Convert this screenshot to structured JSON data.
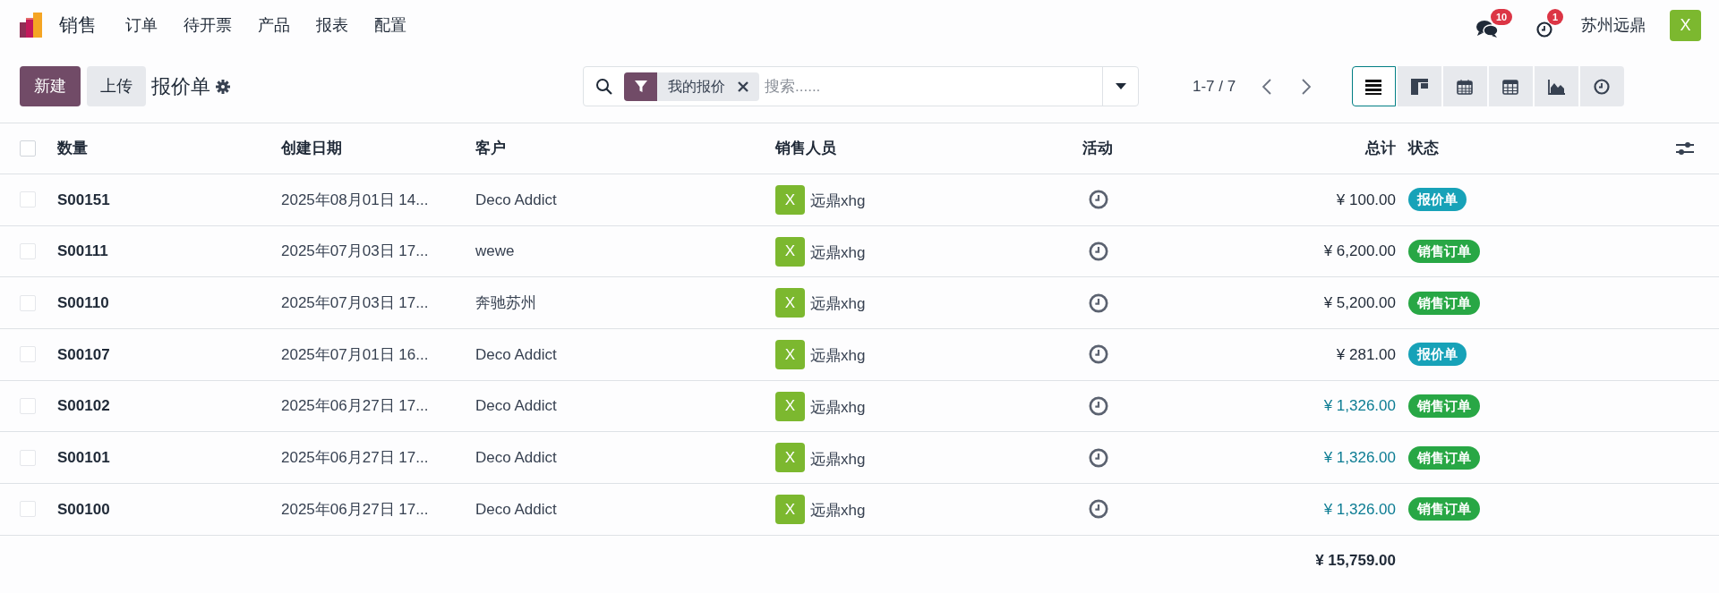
{
  "nav": {
    "app": "销售",
    "menu": [
      "订单",
      "待开票",
      "产品",
      "报表",
      "配置"
    ],
    "messages_count": "10",
    "activities_count": "1",
    "company": "苏州远鼎",
    "avatar": "X"
  },
  "control": {
    "new_button": "新建",
    "upload_button": "上传",
    "title": "报价单",
    "facet": "我的报价",
    "placeholder": "搜索......",
    "pager": "1-7 / 7",
    "views": [
      {
        "kind": "list",
        "selected": true
      },
      {
        "kind": "kanban",
        "selected": false
      },
      {
        "kind": "calendar",
        "selected": false
      },
      {
        "kind": "pivot",
        "selected": false
      },
      {
        "kind": "graph",
        "selected": false
      },
      {
        "kind": "activity",
        "selected": false
      }
    ]
  },
  "table": {
    "all_checked": false,
    "columns": [
      "数量",
      "创建日期",
      "客户",
      "销售人员",
      "活动",
      "总计",
      "状态"
    ],
    "rows": [
      {
        "number": "S00151",
        "date": "2025年08月01日 14...",
        "customer": "Deco Addict",
        "avatar": "X",
        "salesperson": "远鼎xhg",
        "total": "¥ 100.00",
        "highlight": false,
        "status": "报价单",
        "color": "#17a2b8",
        "checked": false
      },
      {
        "number": "S00111",
        "date": "2025年07月03日 17...",
        "customer": "wewe",
        "avatar": "X",
        "salesperson": "远鼎xhg",
        "total": "¥ 6,200.00",
        "highlight": false,
        "status": "销售订单",
        "color": "#28a745",
        "checked": false
      },
      {
        "number": "S00110",
        "date": "2025年07月03日 17...",
        "customer": "奔驰苏州",
        "avatar": "X",
        "salesperson": "远鼎xhg",
        "total": "¥ 5,200.00",
        "highlight": false,
        "status": "销售订单",
        "color": "#28a745",
        "checked": false
      },
      {
        "number": "S00107",
        "date": "2025年07月01日 16...",
        "customer": "Deco Addict",
        "avatar": "X",
        "salesperson": "远鼎xhg",
        "total": "¥ 281.00",
        "highlight": false,
        "status": "报价单",
        "color": "#17a2b8",
        "checked": false
      },
      {
        "number": "S00102",
        "date": "2025年06月27日 17...",
        "customer": "Deco Addict",
        "avatar": "X",
        "salesperson": "远鼎xhg",
        "total": "¥ 1,326.00",
        "highlight": true,
        "status": "销售订单",
        "color": "#28a745",
        "checked": false
      },
      {
        "number": "S00101",
        "date": "2025年06月27日 17...",
        "customer": "Deco Addict",
        "avatar": "X",
        "salesperson": "远鼎xhg",
        "total": "¥ 1,326.00",
        "highlight": true,
        "status": "销售订单",
        "color": "#28a745",
        "checked": false
      },
      {
        "number": "S00100",
        "date": "2025年06月27日 17...",
        "customer": "Deco Addict",
        "avatar": "X",
        "salesperson": "远鼎xhg",
        "total": "¥ 1,326.00",
        "highlight": true,
        "status": "销售订单",
        "color": "#28a745",
        "checked": false
      }
    ],
    "sum": "¥ 15,759.00"
  }
}
